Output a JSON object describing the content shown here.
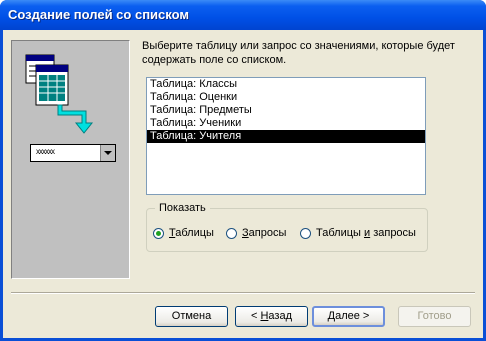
{
  "window": {
    "title": "Создание полей со списком"
  },
  "prompt": "Выберите таблицу или запрос со значениями, которые будет содержать поле со списком.",
  "illustration": {
    "combo_text": "xxxxxx"
  },
  "tables": [
    "Таблица: Классы",
    "Таблица: Оценки",
    "Таблица: Предметы",
    "Таблица: Ученики",
    "Таблица: Учителя"
  ],
  "selected_table": "Таблица: Учителя",
  "show_group": {
    "legend": "Показать",
    "options": [
      {
        "pre": "",
        "key": "Т",
        "post": "аблицы",
        "checked": true
      },
      {
        "pre": "",
        "key": "З",
        "post": "апросы",
        "checked": false
      },
      {
        "pre": "Таблицы ",
        "key": "и",
        "post": " запросы",
        "checked": false
      }
    ]
  },
  "buttons": {
    "cancel": "Отмена",
    "back": {
      "pre": "< ",
      "key": "Н",
      "post": "азад"
    },
    "next": {
      "pre": "",
      "key": "Д",
      "post": "алее >"
    },
    "finish": "Готово"
  }
}
